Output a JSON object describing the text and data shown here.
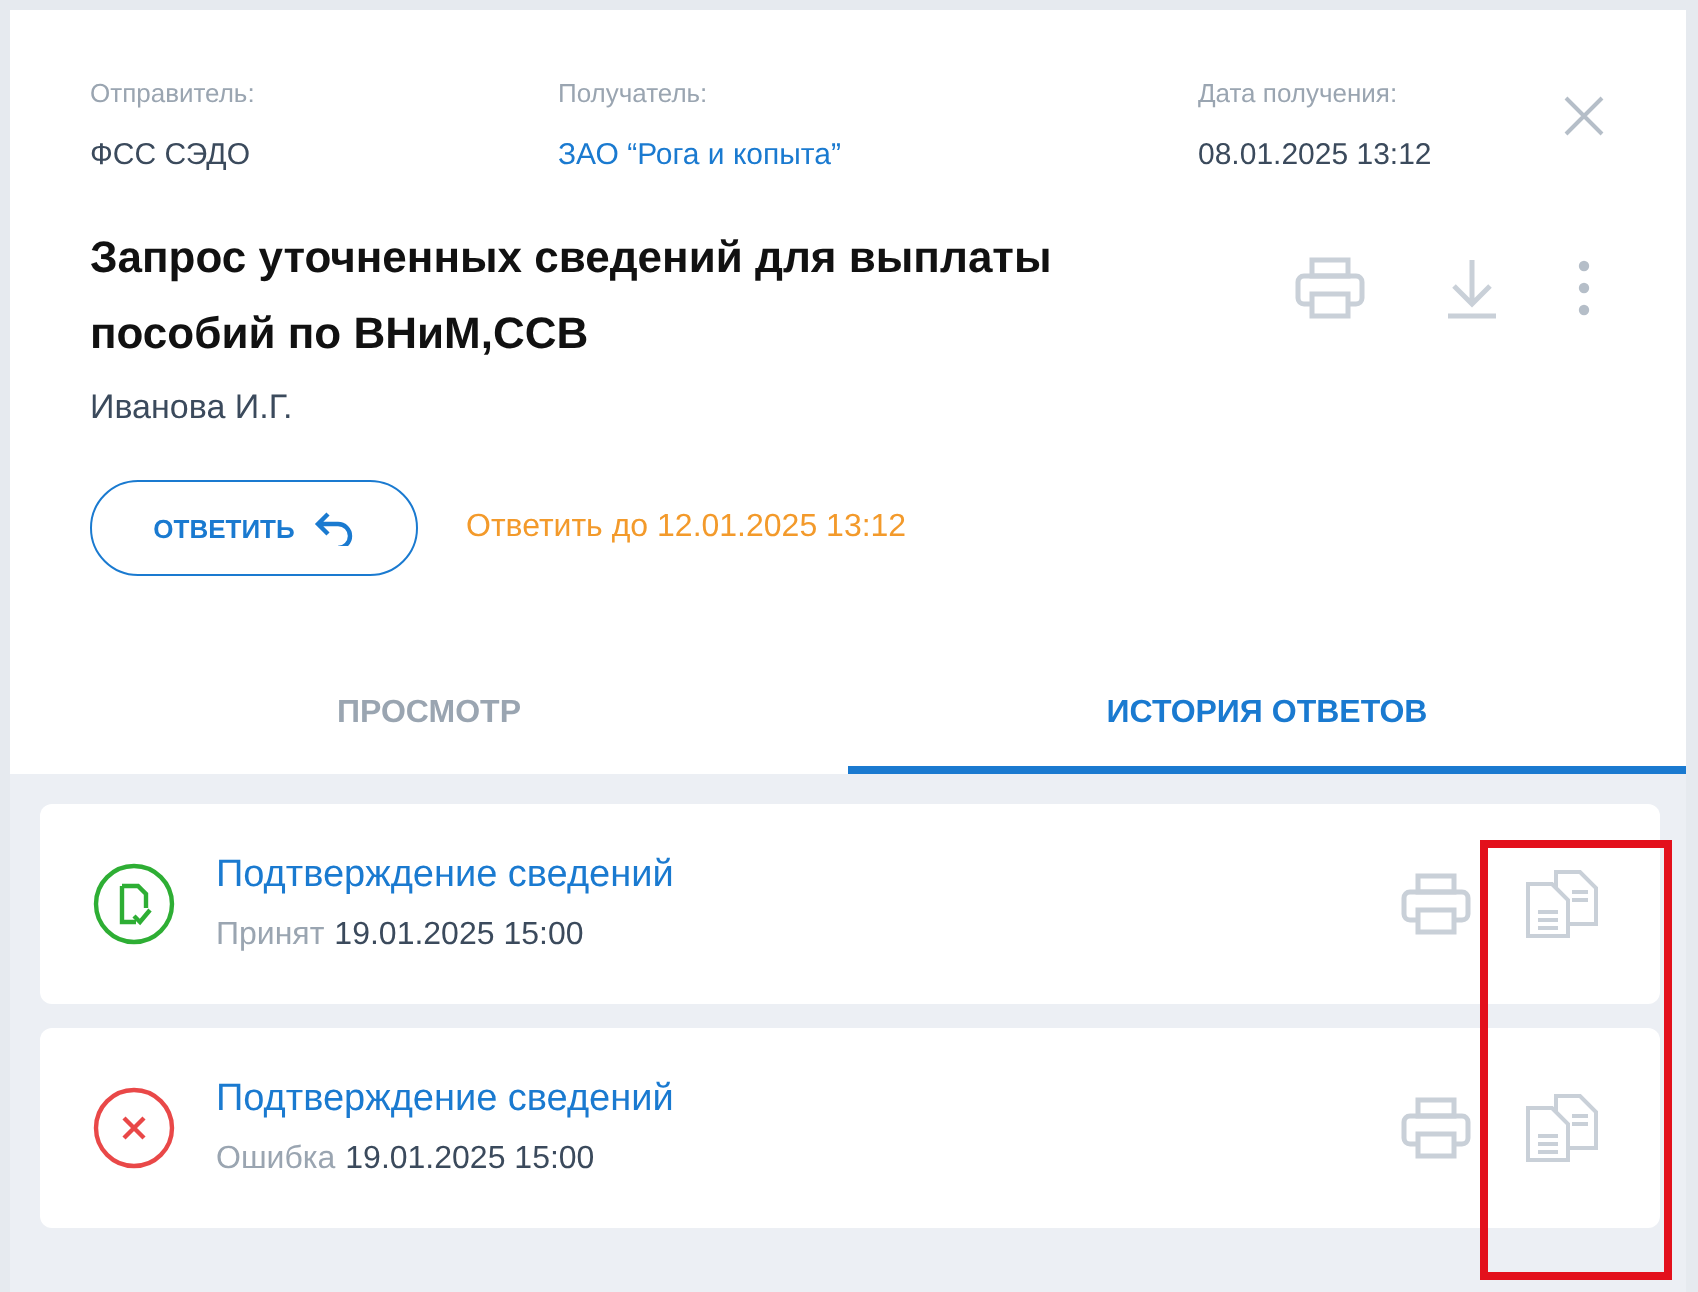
{
  "meta": [
    {
      "label": "Отправитель:",
      "value": "ФСС СЭДО",
      "link": false
    },
    {
      "label": "Получатель:",
      "value": "ЗАО “Рога и копыта”",
      "link": true
    },
    {
      "label": "Дата получения:",
      "value": "08.01.2025 13:12",
      "link": false
    }
  ],
  "title": "Запрос уточненных сведений для выплаты пособий по ВНиМ,ССВ",
  "author": "Иванова И.Г.",
  "reply_button": "ОТВЕТИТЬ",
  "deadline": "Ответить до 12.01.2025 13:12",
  "tabs": [
    {
      "label": "ПРОСМОТР",
      "selected": false
    },
    {
      "label": "ИСТОРИЯ ОТВЕТОВ",
      "selected": true
    }
  ],
  "responses": [
    {
      "title": "Подтверждение сведений",
      "kind": "accepted",
      "status": "Принят",
      "date": "19.01.2025 15:00"
    },
    {
      "title": "Подтверждение сведений",
      "kind": "error",
      "status": "Ошибка",
      "date": "19.01.2025 15:00"
    }
  ]
}
